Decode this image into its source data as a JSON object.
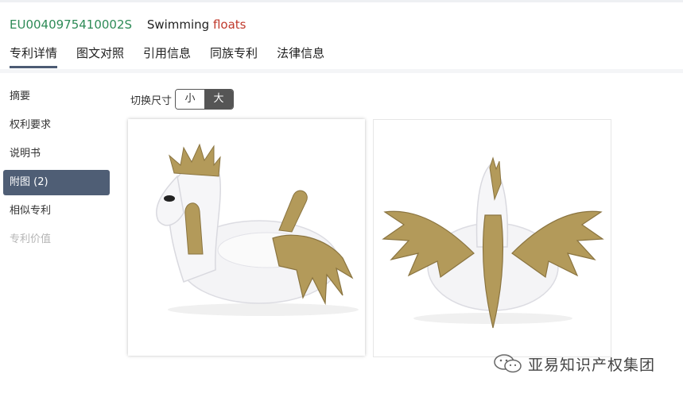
{
  "header": {
    "patent_id": "EU0040975410002S",
    "title_main": "Swimming ",
    "title_highlight": "floats"
  },
  "tabs": [
    {
      "label": "专利详情",
      "active": true
    },
    {
      "label": "图文对照",
      "active": false
    },
    {
      "label": "引用信息",
      "active": false
    },
    {
      "label": "同族专利",
      "active": false
    },
    {
      "label": "法律信息",
      "active": false
    }
  ],
  "sidebar": {
    "items": [
      {
        "label": "摘要"
      },
      {
        "label": "权利要求"
      },
      {
        "label": "说明书"
      },
      {
        "label": "附图 (2)",
        "active": true
      },
      {
        "label": "相似专利"
      },
      {
        "label": "专利价值",
        "disabled": true
      }
    ]
  },
  "size_switch": {
    "label": "切换尺寸",
    "small": "小",
    "large": "大",
    "selected": "大"
  },
  "figures": [
    {
      "name": "figure-1",
      "icon": "unicorn-float-side-view"
    },
    {
      "name": "figure-2",
      "icon": "unicorn-float-back-view"
    }
  ],
  "watermark": {
    "text": "亚易知识产权集团",
    "icon": "wechat-icon"
  },
  "colors": {
    "patent_id": "#2e8b57",
    "highlight": "#c0392b",
    "active_item": "#4f5e75",
    "gold": "#b39a5a"
  }
}
